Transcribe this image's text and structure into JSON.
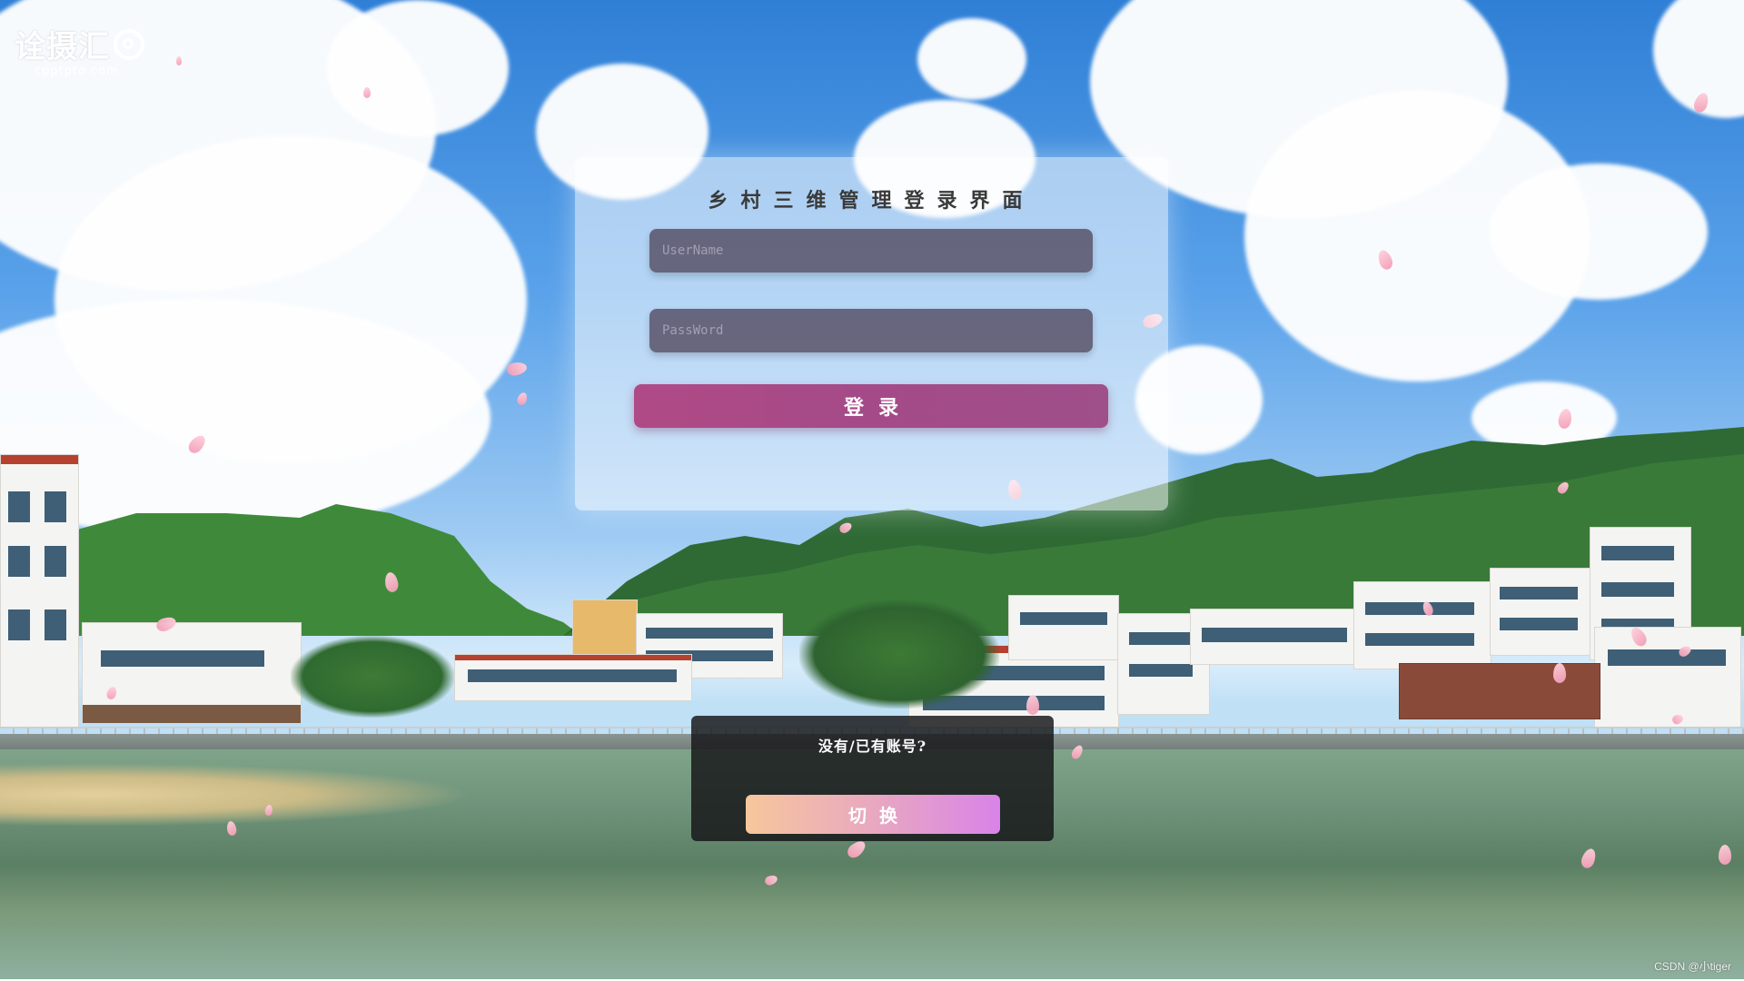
{
  "logo": {
    "main": "诠摄汇",
    "sub": "cpptpto.com"
  },
  "login": {
    "title": "乡村三维管理登录界面",
    "username_placeholder": "UserName",
    "password_placeholder": "PassWord",
    "login_label": "登录"
  },
  "switch": {
    "prompt": "没有/已有账号?",
    "button_label": "切换"
  },
  "watermark": "CSDN @小tiger",
  "colors": {
    "login_button": "#a94a87",
    "input_bg": "#585268",
    "switch_panel": "#141416",
    "switch_gradient_start": "#f6c79c",
    "switch_gradient_end": "#d983e8"
  }
}
